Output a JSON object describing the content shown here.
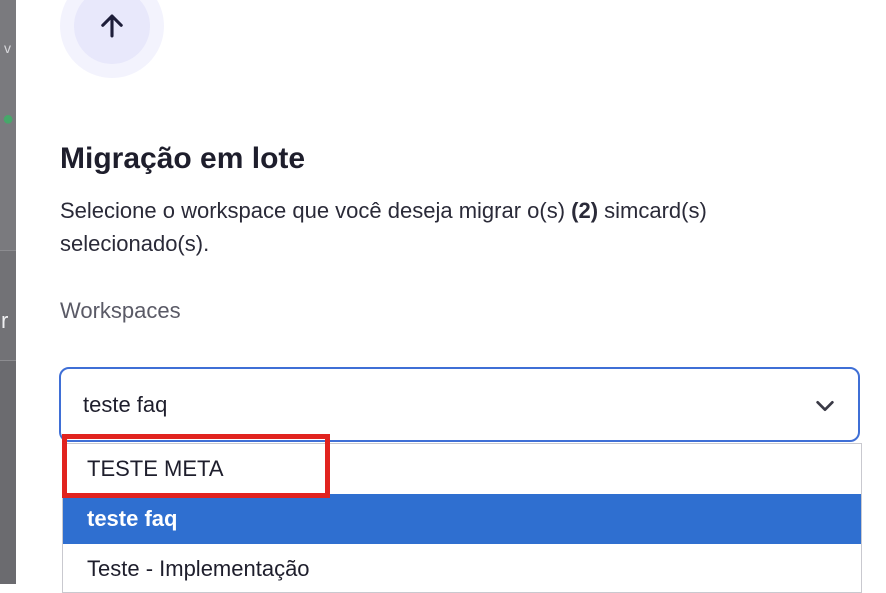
{
  "modal": {
    "title": "Migração em lote",
    "description_prefix": "Selecione o workspace que você deseja migrar o(s) ",
    "description_count": "(2)",
    "description_suffix": " simcard(s) selecionado(s).",
    "icon": "arrow-up-icon"
  },
  "workspaces": {
    "label": "Workspaces",
    "selected_value": "teste faq",
    "options": [
      {
        "label": "TESTE META",
        "selected": false,
        "annotated": true
      },
      {
        "label": "teste faq",
        "selected": true
      },
      {
        "label": "Teste - Implementação",
        "selected": false
      }
    ]
  },
  "colors": {
    "accent": "#2f6fd0",
    "focus_border": "#3f6fd6",
    "annotation": "#e1231f",
    "icon_bg": "#e8e8fb"
  }
}
